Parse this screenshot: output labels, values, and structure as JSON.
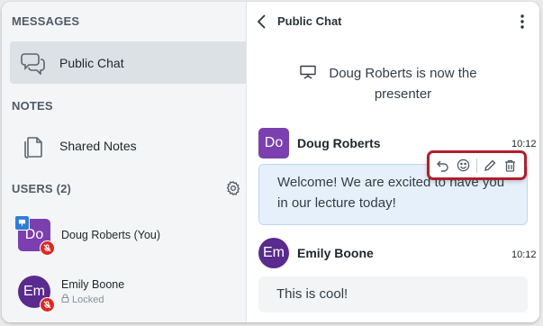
{
  "sidebar": {
    "messages_title": "MESSAGES",
    "public_chat_label": "Public Chat",
    "notes_title": "NOTES",
    "shared_notes_label": "Shared Notes",
    "users_title": "USERS (2)",
    "users": [
      {
        "initials": "Do",
        "name": "Doug Roberts (You)",
        "status": ""
      },
      {
        "initials": "Em",
        "name": "Emily Boone",
        "status": "Locked"
      }
    ]
  },
  "chat": {
    "title": "Public Chat",
    "system_message": "Doug Roberts is now the presenter",
    "messages": [
      {
        "initials": "Do",
        "author": "Doug Roberts",
        "time": "10:12",
        "text": "Welcome! We are excited to have you in our lecture today!"
      },
      {
        "initials": "Em",
        "author": "Emily Boone",
        "time": "10:12",
        "text": "This is cool!"
      }
    ]
  },
  "colors": {
    "avatar_doug": "#7b3fb0",
    "avatar_emily": "#5a2a8e",
    "highlight_outline": "#b01f2c",
    "mic_muted": "#df2721",
    "presenter_badge": "#2f7dd8"
  },
  "icons": {
    "public_chat": "chat-bubbles-icon",
    "shared_notes": "document-icon",
    "users_settings": "gear-icon",
    "back": "chevron-left-icon",
    "more": "kebab-menu-icon",
    "presenter": "presentation-board-icon",
    "message_actions": [
      "reply-icon",
      "emoji-reaction-icon",
      "edit-icon",
      "delete-icon"
    ]
  }
}
